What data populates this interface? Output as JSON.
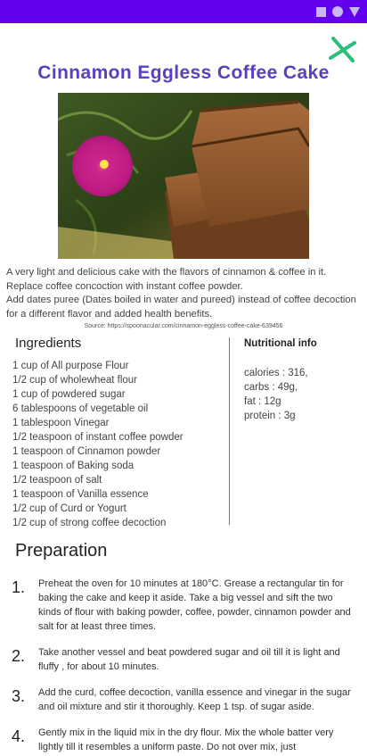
{
  "colors": {
    "status_bar": "#6200ee",
    "title": "#5a3fc0",
    "close_icon": "#2bbf7a"
  },
  "status_bar": {
    "icons": [
      "square-icon",
      "circle-icon",
      "triangle-icon"
    ]
  },
  "close_button": {
    "icon": "close-icon"
  },
  "recipe": {
    "title": "Cinnamon Eggless Coffee Cake",
    "image": {
      "subject": "cinnamon-coffee-cake-photo"
    },
    "description": [
      "A very light and delicious cake with the flavors of cinnamon & coffee in it.",
      "Replace coffee concoction with instant coffee powder.",
      "Add dates puree (Dates boiled in water and pureed) instead of coffee decoction for a different flavor and added health benefits."
    ],
    "source": "Source: https://spoonacular.com/cinnamon-eggless-coffee-cake-639456"
  },
  "ingredients": {
    "title": "Ingredients",
    "items": [
      "1 cup of All purpose Flour",
      "1/2 cup of wholewheat flour",
      "1 cup of powdered sugar",
      "6 tablespoons of vegetable oil",
      "1 tablespoon Vinegar",
      "1/2 teaspoon of instant coffee powder",
      "1 teaspoon of Cinnamon powder",
      "1 teaspoon of Baking soda",
      "1/2 teaspoon of salt",
      "1 teaspoon of Vanilla essence",
      "1/2 cup of Curd or Yogurt",
      "1/2 cup of strong coffee decoction"
    ]
  },
  "nutrition": {
    "title": "Nutritional info",
    "items": [
      "calories : 316,",
      "carbs : 49g,",
      "fat : 12g",
      "protein : 3g"
    ]
  },
  "preparation": {
    "title": "Preparation",
    "steps": [
      {
        "num": "1.",
        "text": "Preheat the oven for 10 minutes at 180°C. Grease a rectangular tin for baking the cake and keep it aside. Take a big vessel and sift the two kinds of flour with baking powder, coffee, powder, cinnamon powder and salt for at least three times."
      },
      {
        "num": "2.",
        "text": "Take another vessel and beat powdered sugar and oil till it is light and fluffy , for about 10 minutes."
      },
      {
        "num": "3.",
        "text": "Add the curd, coffee decoction, vanilla essence and vinegar in the sugar and oil mixture and stir it thoroughly. Keep 1 tsp. of sugar aside."
      },
      {
        "num": "4.",
        "text": "Gently mix in the liquid mix in the dry flour. Mix the whole batter very lightly till it resembles a uniform paste. Do not over mix, just"
      }
    ]
  }
}
